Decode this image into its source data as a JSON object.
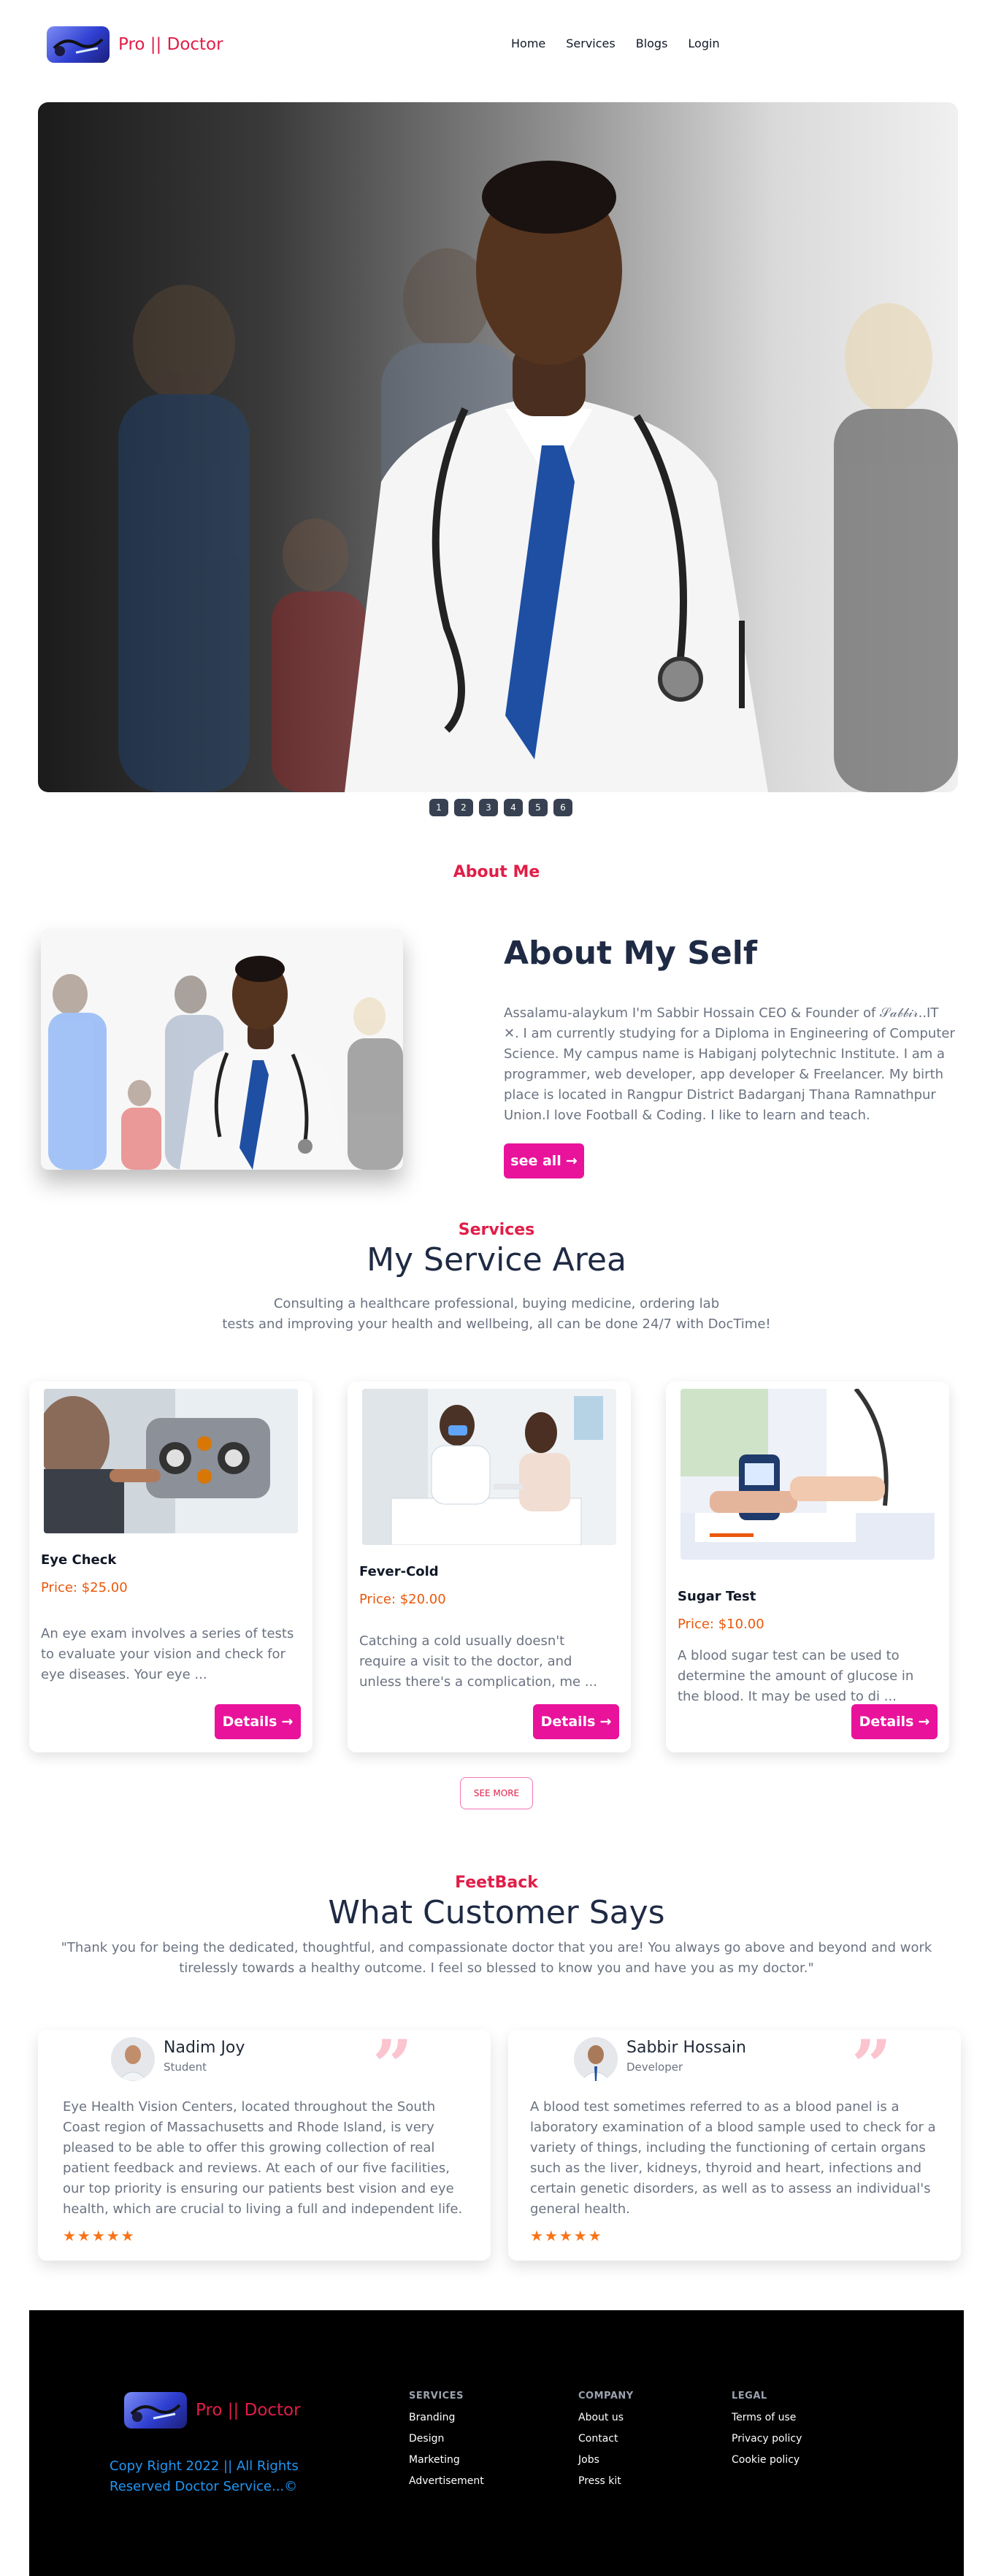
{
  "nav": {
    "brand": "Pro || Doctor",
    "links": [
      "Home",
      "Services",
      "Blogs",
      "Login"
    ]
  },
  "carousel": {
    "slides": [
      "1",
      "2",
      "3",
      "4",
      "5",
      "6"
    ]
  },
  "about": {
    "label": "About Me",
    "title": "About My Self",
    "text": "Assalamu-alaykum I'm Sabbir Hossain CEO & Founder of 𝒮𝒶𝒷𝒷𝒾𝓇..IT ✕. I am currently studying for a Diploma in Engineering of Computer Science. My campus name is Habiganj polytechnic Institute. I am a programmer, web developer, app developer & Freelancer. My birth place is located in Rangpur District Badarganj Thana Ramnathpur Union.I love Football & Coding. I like to learn and teach.",
    "button": "see all"
  },
  "services": {
    "label": "Services",
    "title": "My Service Area",
    "subtitle_line1": "Consulting a healthcare professional, buying medicine, ordering lab",
    "subtitle_line2": "tests and improving your health and wellbeing, all can be done 24/7 with DocTime!",
    "cards": [
      {
        "title": "Eye Check",
        "price": "Price: $25.00",
        "text": "An eye exam involves a series of tests to evaluate your vision and check for eye diseases. Your eye ...",
        "button": "Details"
      },
      {
        "title": "Fever-Cold",
        "price": "Price: $20.00",
        "text": "Catching a cold usually doesn't require a visit to the doctor, and unless there's a complication, me ...",
        "button": "Details"
      },
      {
        "title": "Sugar Test",
        "price": "Price: $10.00",
        "text": "A blood sugar test can be used to determine the amount of glucose in the blood. It may be used to di ...",
        "button": "Details"
      }
    ],
    "see_more": "SEE MORE"
  },
  "feedback": {
    "label": "FeetBack",
    "title": "What Customer Says",
    "quote": "\"Thank you for being the dedicated, thoughtful, and compassionate doctor that you are! You always go above and beyond and work tirelessly towards a healthy outcome. I feel so blessed to know you and have you as my doctor.\"",
    "reviews": [
      {
        "name": "Nadim Joy",
        "role": "Student",
        "text": "Eye Health Vision Centers, located throughout the South Coast region of Massachusetts and Rhode Island, is very pleased to be able to offer this growing collection of real patient feedback and reviews. At each of our five facilities, our top priority is ensuring our patients best vision and eye health, which are crucial to living a full and independent life.",
        "stars": "★★★★★"
      },
      {
        "name": "Sabbir Hossain",
        "role": "Developer",
        "text": "A blood test sometimes referred to as a blood panel is a laboratory examination of a blood sample used to check for a variety of things, including the functioning of certain organs such as the liver, kidneys, thyroid and heart, infections and certain genetic disorders, as well as to assess an individual's general health.",
        "stars": "★★★★★"
      }
    ],
    "quote_mark": "”"
  },
  "footer": {
    "brand": "Pro || Doctor",
    "copyright": "Copy Right 2022 || All Rights Reserved Doctor Service...©",
    "columns": [
      {
        "heading": "SERVICES",
        "links": [
          "Branding",
          "Design",
          "Marketing",
          "Advertisement"
        ]
      },
      {
        "heading": "COMPANY",
        "links": [
          "About us",
          "Contact",
          "Jobs",
          "Press kit"
        ]
      },
      {
        "heading": "LEGAL",
        "links": [
          "Terms of use",
          "Privacy policy",
          "Cookie policy"
        ]
      }
    ]
  },
  "colors": {
    "accent": "#e11d48",
    "button": "#e9129b",
    "price": "#ea580c",
    "star": "#f97316",
    "copyright": "#2196f3"
  },
  "icons": {
    "arrow": "arrow-right-icon",
    "quote": "quote-icon",
    "star": "star-icon"
  }
}
